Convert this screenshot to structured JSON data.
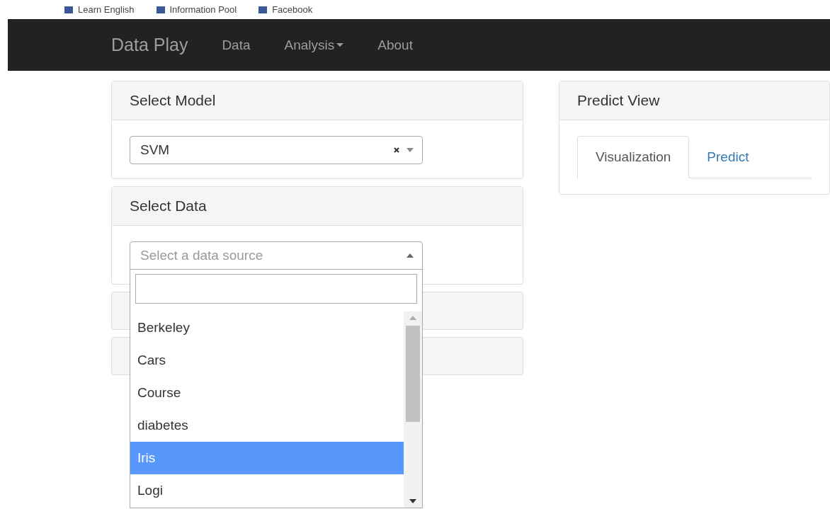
{
  "bookmarks": [
    {
      "label": "Learn English"
    },
    {
      "label": "Information Pool"
    },
    {
      "label": "Facebook"
    }
  ],
  "navbar": {
    "brand": "Data Play",
    "items": [
      {
        "label": "Data",
        "dropdown": false
      },
      {
        "label": "Analysis",
        "dropdown": true
      },
      {
        "label": "About",
        "dropdown": false
      }
    ]
  },
  "model_panel": {
    "title": "Select Model",
    "select": {
      "value": "SVM"
    }
  },
  "data_panel": {
    "title": "Select Data",
    "select": {
      "placeholder": "Select a data source",
      "open": true,
      "options": [
        {
          "label": "Berkeley",
          "selected": false
        },
        {
          "label": "Cars",
          "selected": false
        },
        {
          "label": "Course",
          "selected": false
        },
        {
          "label": "diabetes",
          "selected": false
        },
        {
          "label": "Iris",
          "selected": true
        },
        {
          "label": "Logi",
          "selected": false
        }
      ]
    }
  },
  "predict_panel": {
    "title": "Predict View",
    "tabs": [
      {
        "label": "Visualization",
        "selected": true
      },
      {
        "label": "Predict",
        "selected": false
      }
    ]
  }
}
